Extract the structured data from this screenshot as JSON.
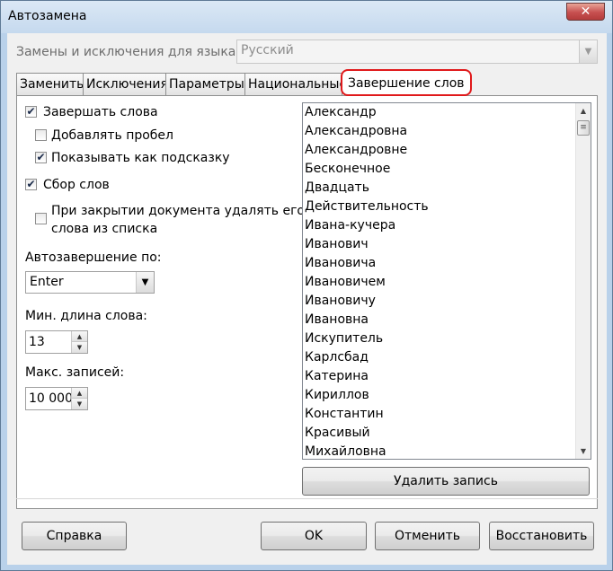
{
  "window": {
    "title": "Автозамена",
    "close_glyph": "✕"
  },
  "language": {
    "label": "Замены и исключения для языка:",
    "value": "Русский"
  },
  "tabs": [
    {
      "label": "Заменить"
    },
    {
      "label": "Исключения"
    },
    {
      "label": "Параметры"
    },
    {
      "label": "Национальные"
    },
    {
      "label": "Завершение слов",
      "active": true
    }
  ],
  "options": {
    "complete_words": {
      "label": "Завершать слова",
      "checked": true
    },
    "add_space": {
      "label": "Добавлять пробел",
      "checked": false
    },
    "show_tip": {
      "label": "Показывать как подсказку",
      "checked": true
    },
    "collect_words": {
      "label": "Сбор слов",
      "checked": true
    },
    "remove_on_close": {
      "label_line1": "При закрытии документа удалять его",
      "label_line2": "слова из списка",
      "checked": false
    }
  },
  "autocomplete": {
    "label": "Автозавершение по:",
    "value": "Enter"
  },
  "min_length": {
    "label": "Мин. длина слова:",
    "value": "13"
  },
  "max_entries": {
    "label": "Макс. записей:",
    "value": "10 000"
  },
  "word_list": [
    "Александр",
    "Александровна",
    "Александровне",
    "Бесконечное",
    "Двадцать",
    "Действительность",
    "Ивана-кучера",
    "Иванович",
    "Ивановича",
    "Ивановичем",
    "Ивановичу",
    "Ивановна",
    "Искупитель",
    "Карлсбад",
    "Катерина",
    "Кириллов",
    "Константин",
    "Красивый",
    "Михайловна"
  ],
  "buttons": {
    "delete_entry": "Удалить запись",
    "help": "Справка",
    "ok": "OK",
    "cancel": "Отменить",
    "restore": "Восстановить"
  },
  "icons": {
    "check_glyph": "✔",
    "combo_arrow": "▼",
    "spin_up": "▲",
    "spin_down": "▼",
    "thumb_grip": "≡"
  },
  "colors": {
    "highlight_red": "#e0191b",
    "title_bar": "#c5d9ee"
  }
}
